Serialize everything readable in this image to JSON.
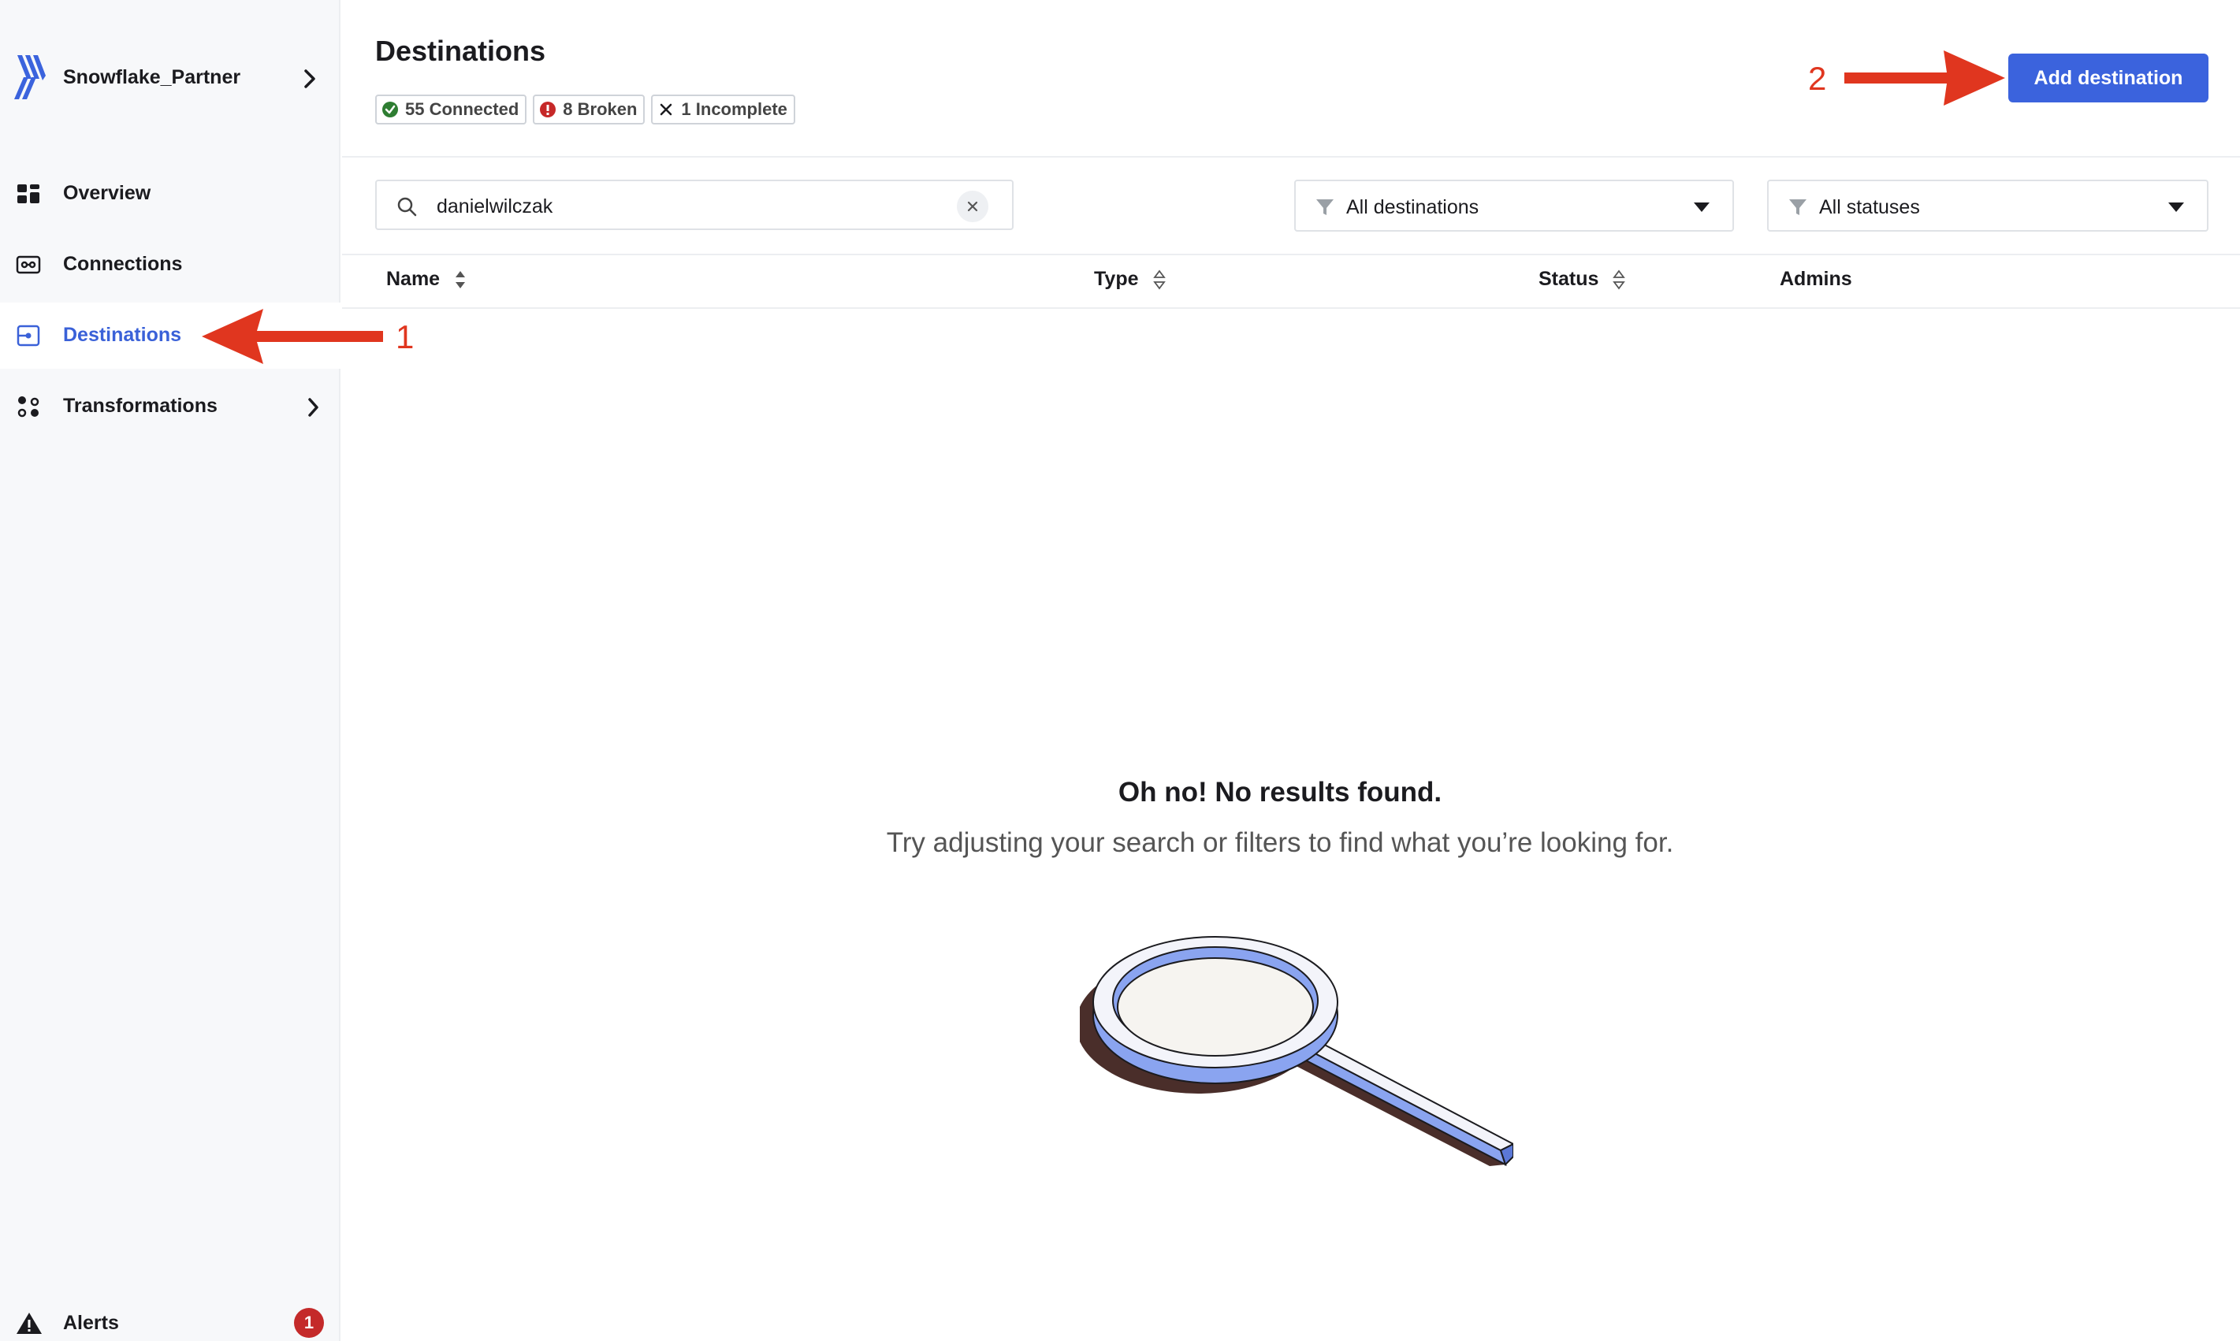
{
  "sidebar": {
    "workspace_name": "Snowflake_Partner",
    "items": [
      {
        "label": "Overview",
        "icon": "dashboard-icon"
      },
      {
        "label": "Connections",
        "icon": "connections-icon"
      },
      {
        "label": "Destinations",
        "icon": "destination-icon",
        "active": true
      },
      {
        "label": "Transformations",
        "icon": "transformations-icon"
      }
    ],
    "alerts": {
      "label": "Alerts",
      "count": "1"
    }
  },
  "header": {
    "title": "Destinations",
    "status_pills": [
      {
        "label": "55 Connected",
        "icon": "check-circle-icon",
        "color": "#2e7d32"
      },
      {
        "label": "8 Broken",
        "icon": "error-circle-icon",
        "color": "#c62828"
      },
      {
        "label": "1 Incomplete",
        "icon": "x-icon",
        "color": "#1b1b1f"
      }
    ],
    "add_button": "Add destination"
  },
  "filters": {
    "search_value": "danielwilczak",
    "destination_filter": "All destinations",
    "status_filter": "All statuses"
  },
  "table": {
    "columns": [
      "Name",
      "Type",
      "Status",
      "Admins"
    ]
  },
  "empty_state": {
    "title": "Oh no! No results found.",
    "subtitle": "Try adjusting your search or filters to find what you’re looking for."
  },
  "annotations": {
    "step_1": "1",
    "step_2": "2",
    "arrow_color": "#e0361f"
  },
  "colors": {
    "accent": "#3b63dd",
    "sidebar_bg": "#f7f8fa",
    "alert_badge": "#c42a2a"
  }
}
